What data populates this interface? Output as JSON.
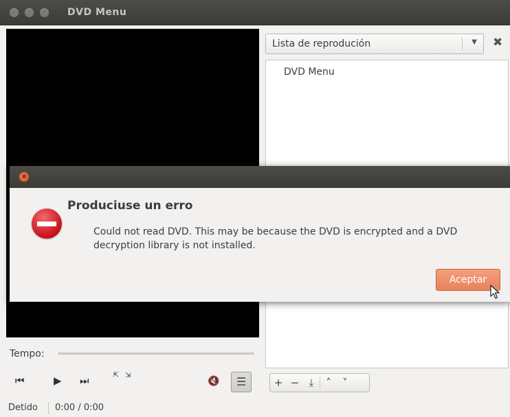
{
  "window": {
    "title": "DVD Menu",
    "close_glyph": "×"
  },
  "playlist": {
    "dropdown_label": "Lista de reprodución",
    "dropdown_arrow": "▼",
    "close_glyph": "✖",
    "items": [
      "DVD Menu"
    ],
    "tools": {
      "add": "+",
      "remove": "−",
      "save": "⤓",
      "up": "˄",
      "down": "˅"
    }
  },
  "controls": {
    "tempo_label": "Tempo:",
    "prev": "⏮",
    "play": "▶",
    "next": "⏭",
    "fullscreen": "⇱ ⇲",
    "volume": "🔇",
    "playlist_toggle": "☰"
  },
  "status": {
    "text": "Detido",
    "time": "0:00 / 0:00"
  },
  "dialog": {
    "close_glyph": "×",
    "heading": "Produciuse un erro",
    "message": "Could not read DVD. This may be because the DVD is encrypted and a DVD decryption library is not installed.",
    "button_label": "Aceptar"
  },
  "colors": {
    "accent": "#e8825c",
    "titlebar": "#3c3b37",
    "error_icon": "#c8101a"
  }
}
